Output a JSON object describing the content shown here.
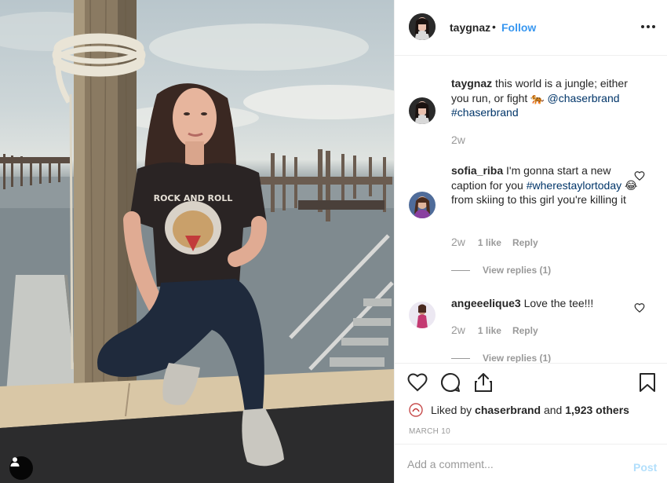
{
  "post": {
    "username": "taygnaz",
    "separator": "•",
    "follow_label": "Follow",
    "more_icon": "more-horizontal-icon"
  },
  "caption": {
    "username": "taygnaz",
    "text_part1": "this world is a jungle; either you run, or fight",
    "emoji": "🐅",
    "mention": "@chaserbrand",
    "hashtag": "#chaserbrand",
    "age": "2w"
  },
  "comments": [
    {
      "username": "sofia_riba",
      "text_part1": "I'm gonna start a new caption for you",
      "hashtag": "#wherestaylortoday",
      "emoji": "😂",
      "text_part2": "from skiing to this girl you're killing it",
      "age": "2w",
      "likes": "1 like",
      "reply_label": "Reply",
      "view_replies": "View replies (1)"
    },
    {
      "username": "angeeelique3",
      "text_part1": "Love the tee!!!",
      "age": "2w",
      "likes": "1 like",
      "reply_label": "Reply",
      "view_replies": "View replies (1)"
    }
  ],
  "actions": {
    "icons": [
      "heart-icon",
      "comment-icon",
      "share-icon",
      "bookmark-icon"
    ]
  },
  "likes": {
    "prefix": "Liked by",
    "user": "chaserbrand",
    "connector": "and",
    "others": "1,923 others"
  },
  "date": "MARCH 10",
  "add_comment": {
    "placeholder": "Add a comment...",
    "post_label": "Post"
  },
  "colors": {
    "link_blue": "#3897f0",
    "mention_blue": "#003569",
    "muted_gray": "#999999",
    "post_disabled": "#b2dffc"
  }
}
